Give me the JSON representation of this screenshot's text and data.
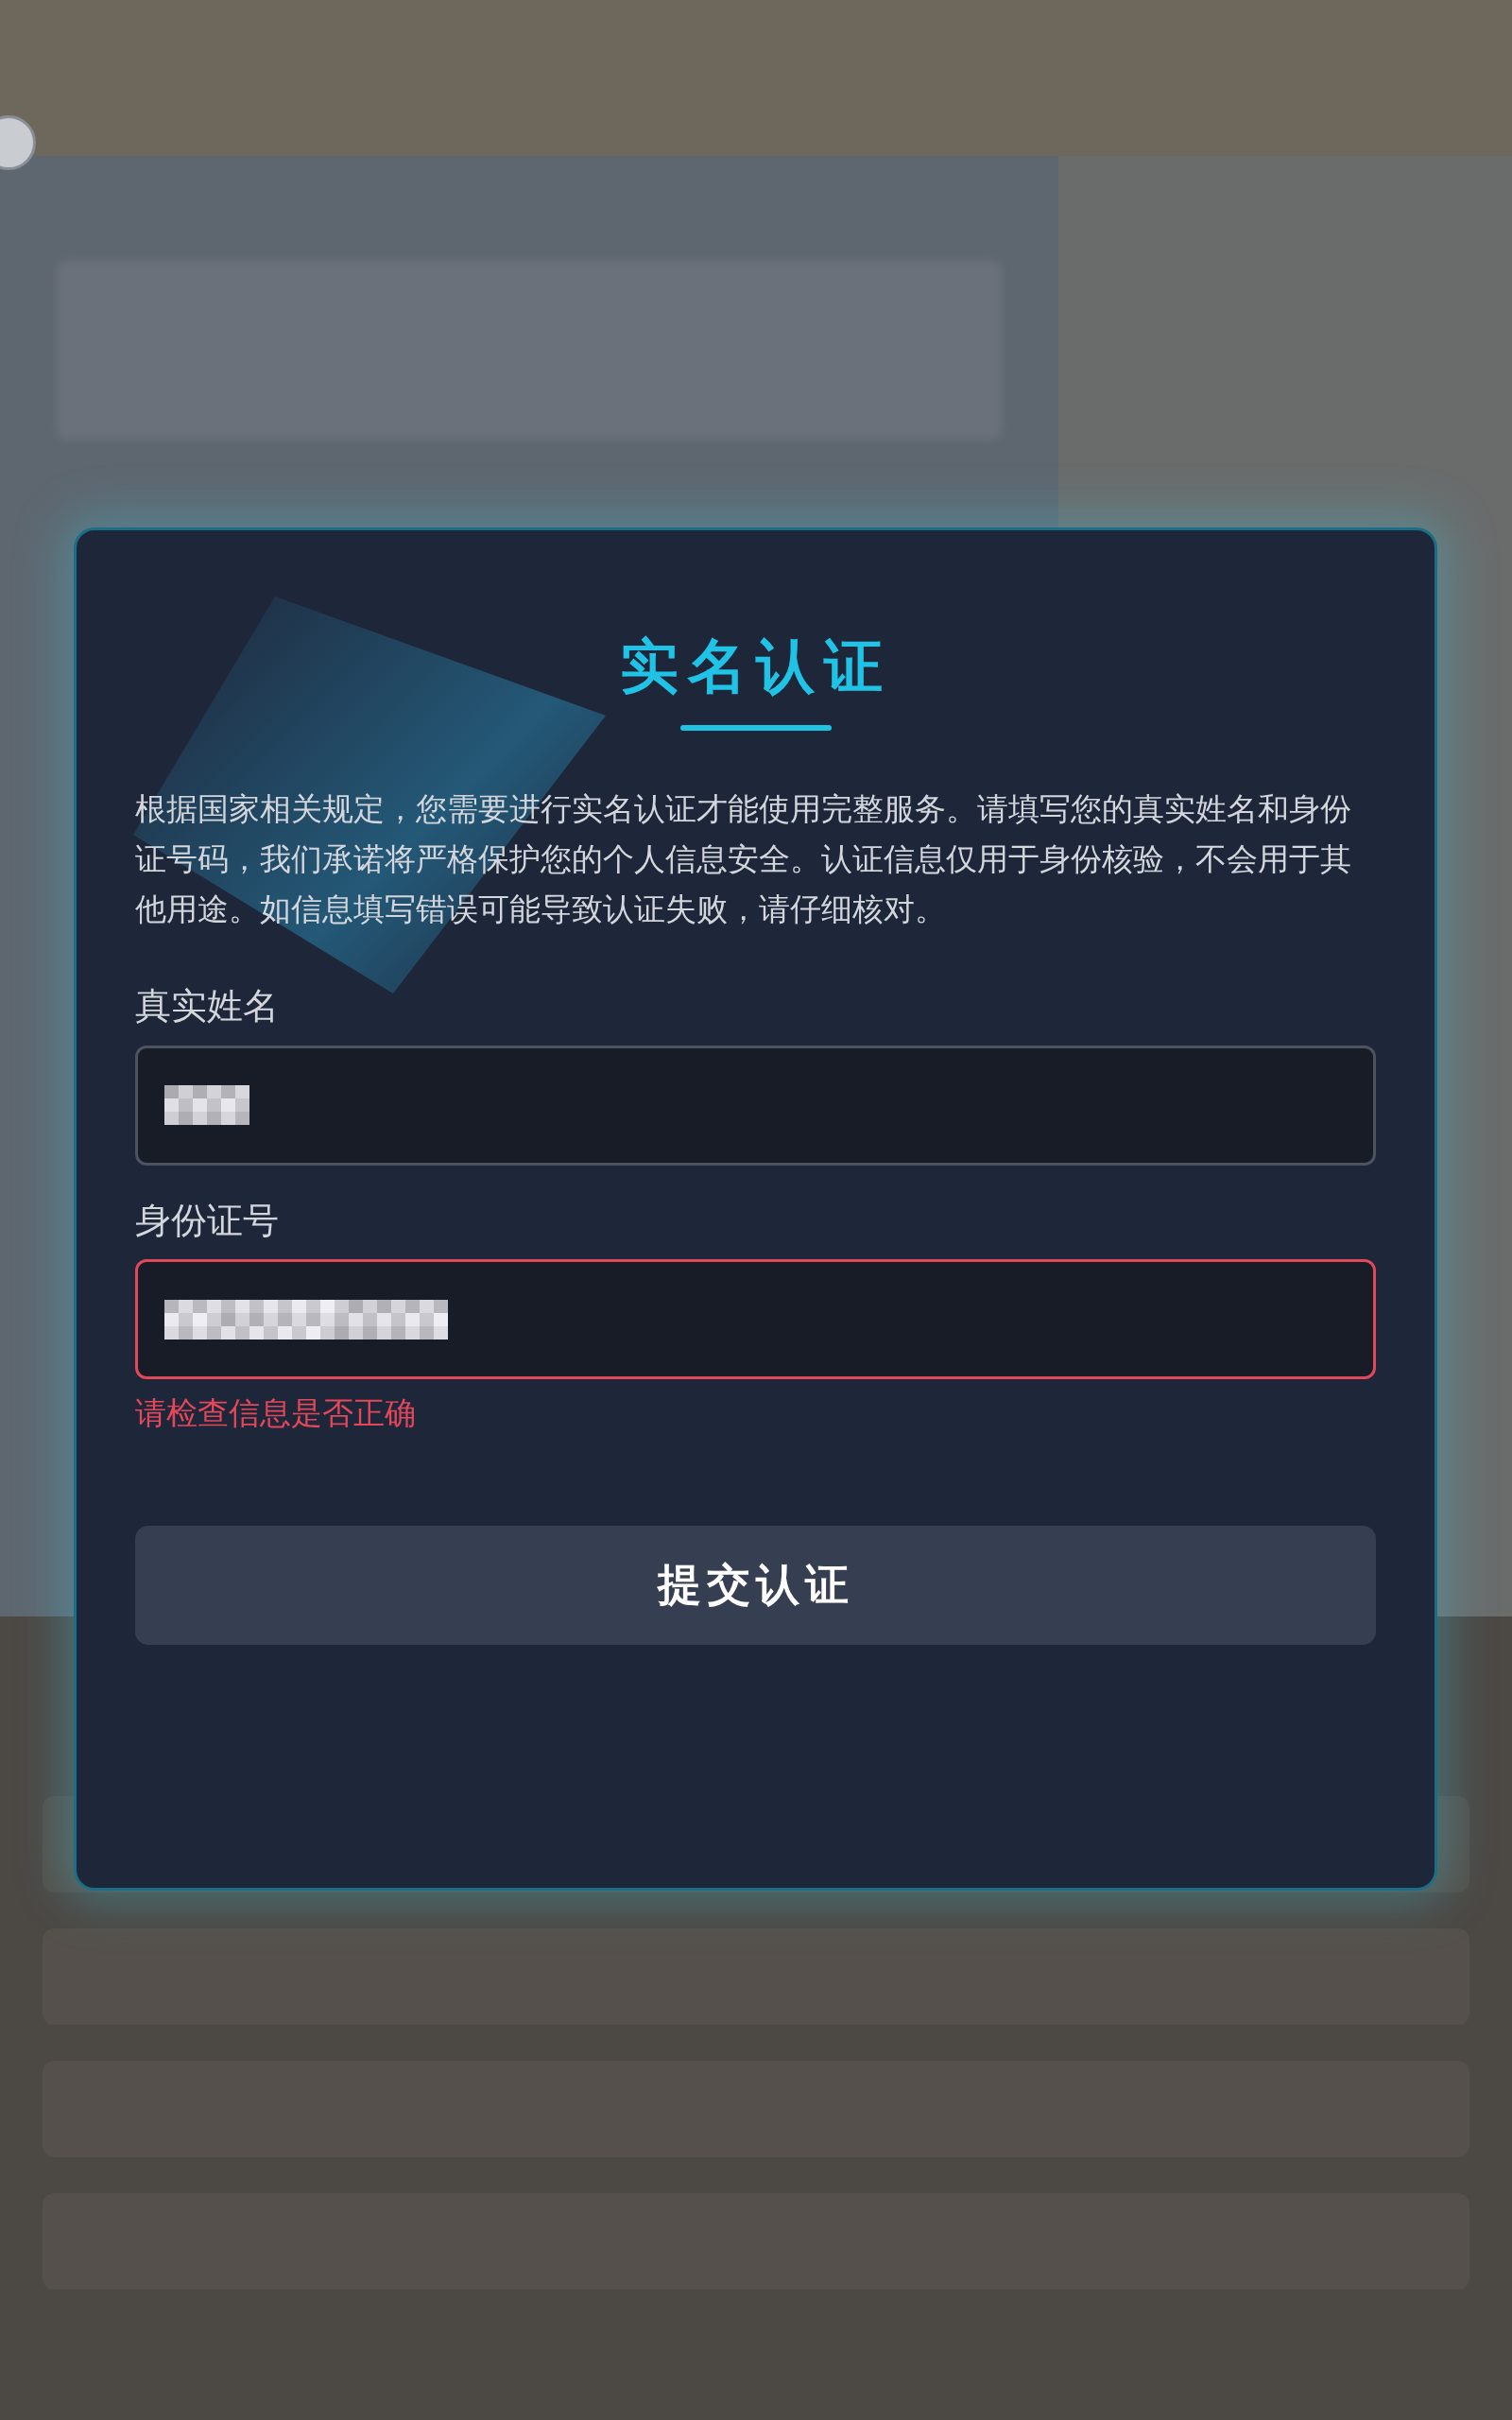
{
  "dialog": {
    "title": "实名认证",
    "description": "根据国家相关规定，您需要进行实名认证才能使用完整服务。请填写您的真实姓名和身份证号码，我们承诺将严格保护您的个人信息安全。认证信息仅用于身份核验，不会用于其他用途。如信息填写错误可能导致认证失败，请仔细核对。",
    "fields": [
      {
        "label": "真实姓名",
        "error": false
      },
      {
        "label": "身份证号",
        "error": true,
        "error_message": "请检查信息是否正确"
      }
    ],
    "submit_button": "提交认证"
  }
}
